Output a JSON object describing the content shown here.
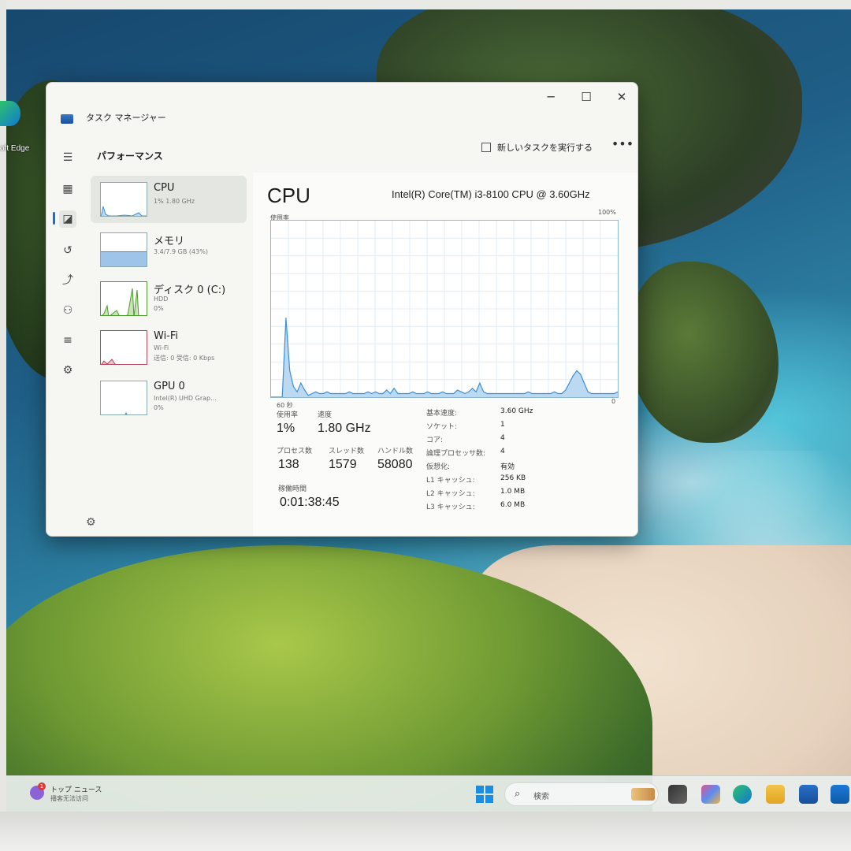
{
  "desktop": {
    "edge_label": "oft Edge"
  },
  "window": {
    "title": "タスク マネージャー",
    "controls": {
      "minimize": "─",
      "maximize": "☐",
      "close": "✕"
    }
  },
  "nav_icons": [
    "hamburger-icon",
    "processes-icon",
    "performance-icon",
    "app-history-icon",
    "startup-icon",
    "users-icon",
    "details-icon",
    "services-icon",
    "settings-icon"
  ],
  "header": {
    "page_title": "パフォーマンス",
    "run_new_task": "新しいタスクを実行する",
    "more": "•••"
  },
  "devices": [
    {
      "name": "CPU",
      "sub1": "1%  1.80 GHz",
      "sub2": "",
      "sub3": ""
    },
    {
      "name": "メモリ",
      "sub1": "3.4/7.9 GB (43%)",
      "sub2": "",
      "sub3": ""
    },
    {
      "name": "ディスク 0 (C:)",
      "sub1": "HDD",
      "sub2": "0%",
      "sub3": ""
    },
    {
      "name": "Wi-Fi",
      "sub1": "Wi-Fi",
      "sub2": "送信: 0 受信: 0 Kbps",
      "sub3": ""
    },
    {
      "name": "GPU 0",
      "sub1": "Intel(R) UHD Grap...",
      "sub2": "0%",
      "sub3": ""
    }
  ],
  "detail": {
    "title": "CPU",
    "model": "Intel(R) Core(TM) i3-8100 CPU @ 3.60GHz",
    "graph_label": "使用率",
    "graph_max": "100%",
    "graph_x_left": "60 秒",
    "graph_x_right": "0",
    "stats": {
      "utilization_label": "使用率",
      "utilization": "1%",
      "speed_label": "速度",
      "speed": "1.80 GHz",
      "processes_label": "プロセス数",
      "processes": "138",
      "threads_label": "スレッド数",
      "threads": "1579",
      "handles_label": "ハンドル数",
      "handles": "58080",
      "uptime_label": "稼働時間",
      "uptime": "0:01:38:45"
    },
    "specs": [
      {
        "key": "基本速度:",
        "value": "3.60 GHz"
      },
      {
        "key": "ソケット:",
        "value": "1"
      },
      {
        "key": "コア:",
        "value": "4"
      },
      {
        "key": "論理プロセッサ数:",
        "value": "4"
      },
      {
        "key": "仮想化:",
        "value": "有効"
      },
      {
        "key": "L1 キャッシュ:",
        "value": "256 KB"
      },
      {
        "key": "L2 キャッシュ:",
        "value": "1.0 MB"
      },
      {
        "key": "L3 キャッシュ:",
        "value": "6.0 MB"
      }
    ],
    "cpu_history_percent": [
      0,
      0,
      0,
      0,
      45,
      15,
      6,
      3,
      8,
      4,
      1,
      2,
      3,
      2,
      2,
      3,
      2,
      2,
      2,
      2,
      2,
      3,
      2,
      2,
      2,
      2,
      3,
      2,
      3,
      2,
      2,
      4,
      2,
      5,
      2,
      2,
      2,
      2,
      3,
      2,
      2,
      2,
      3,
      2,
      2,
      2,
      3,
      2,
      2,
      2,
      4,
      3,
      2,
      3,
      5,
      3,
      8,
      3,
      2,
      2,
      2,
      2,
      2,
      2,
      2,
      2,
      2,
      2,
      2,
      3,
      2,
      2,
      2,
      2,
      2,
      2,
      3,
      2,
      2,
      4,
      8,
      12,
      15,
      13,
      8,
      3,
      2,
      2,
      2,
      2,
      2,
      2,
      2,
      3
    ]
  },
  "taskbar": {
    "news_title": "トップ ニュース",
    "news_sub": "播客无法访问",
    "news_badge": "1",
    "search_placeholder": "検索"
  },
  "colors": {
    "graph_line": "#3b8fd8",
    "graph_fill": "#bcd9f2",
    "memory_fill": "#9fc4ea",
    "disk_line": "#4d9a2f",
    "wifi_line": "#b2485f",
    "accent": "#1a6fd0"
  }
}
